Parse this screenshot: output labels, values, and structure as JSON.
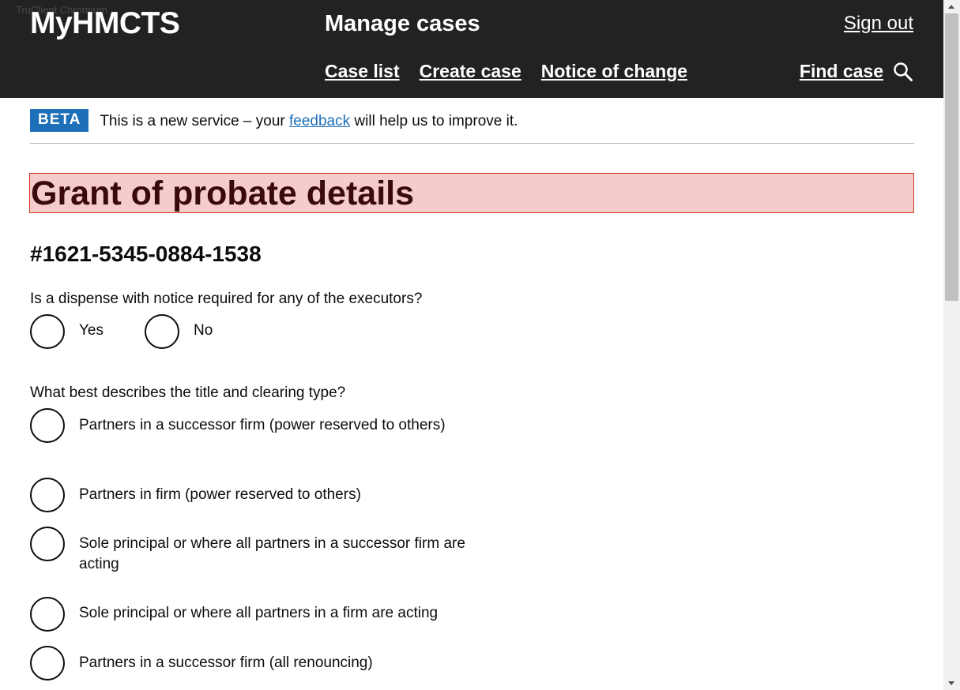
{
  "window": {
    "tag": "TruClient Chromium"
  },
  "header": {
    "logo": "MyHMCTS",
    "service_name": "Manage cases",
    "sign_out": "Sign out",
    "nav": [
      "Case list",
      "Create case",
      "Notice of change"
    ],
    "find_case": "Find case"
  },
  "beta": {
    "tag": "BETA",
    "text_before": "This is a new service – your ",
    "link": "feedback",
    "text_after": " will help us to improve it."
  },
  "page": {
    "title": "Grant of probate details",
    "case_id": "#1621-5345-0884-1538"
  },
  "dispense": {
    "question": "Is a dispense with notice required for any of the executors?",
    "options": [
      "Yes",
      "No"
    ]
  },
  "title_clearing": {
    "question": "What best describes the title and clearing type?",
    "options": [
      "Partners in a successor firm (power reserved to others)",
      "Partners in firm (power reserved to others)",
      "Sole principal or where all partners in a successor firm are acting",
      "Sole principal or where all partners in a firm are acting",
      "Partners in a successor firm (all renouncing)"
    ]
  },
  "colors": {
    "header_bg": "#222222",
    "beta_blue": "#1d70b8",
    "error_highlight": "#f4cccc",
    "error_border": "#d4351c"
  }
}
